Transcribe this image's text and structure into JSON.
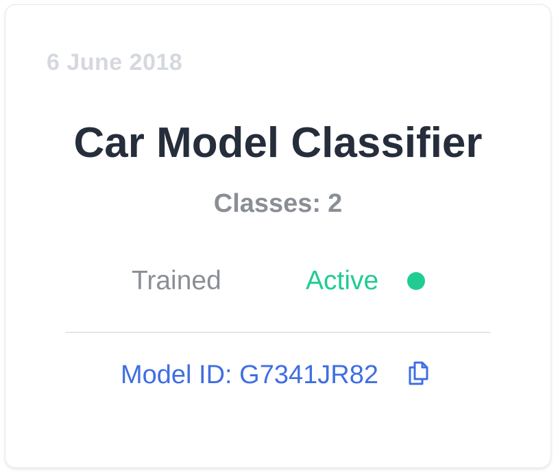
{
  "card": {
    "date": "6 June 2018",
    "title": "Car Model Classifier",
    "classes_label": "Classes:",
    "classes_count": "2",
    "training_status": "Trained",
    "active_status": "Active",
    "model_id_text": "Model ID: G7341JR82",
    "status_dot_color": "#20cc93",
    "copy_icon": "copy-icon"
  },
  "colors": {
    "title": "#262d3b",
    "muted": "#8a8e95",
    "date": "#d5d8dd",
    "active": "#20cc93",
    "link": "#3f6ee3"
  }
}
